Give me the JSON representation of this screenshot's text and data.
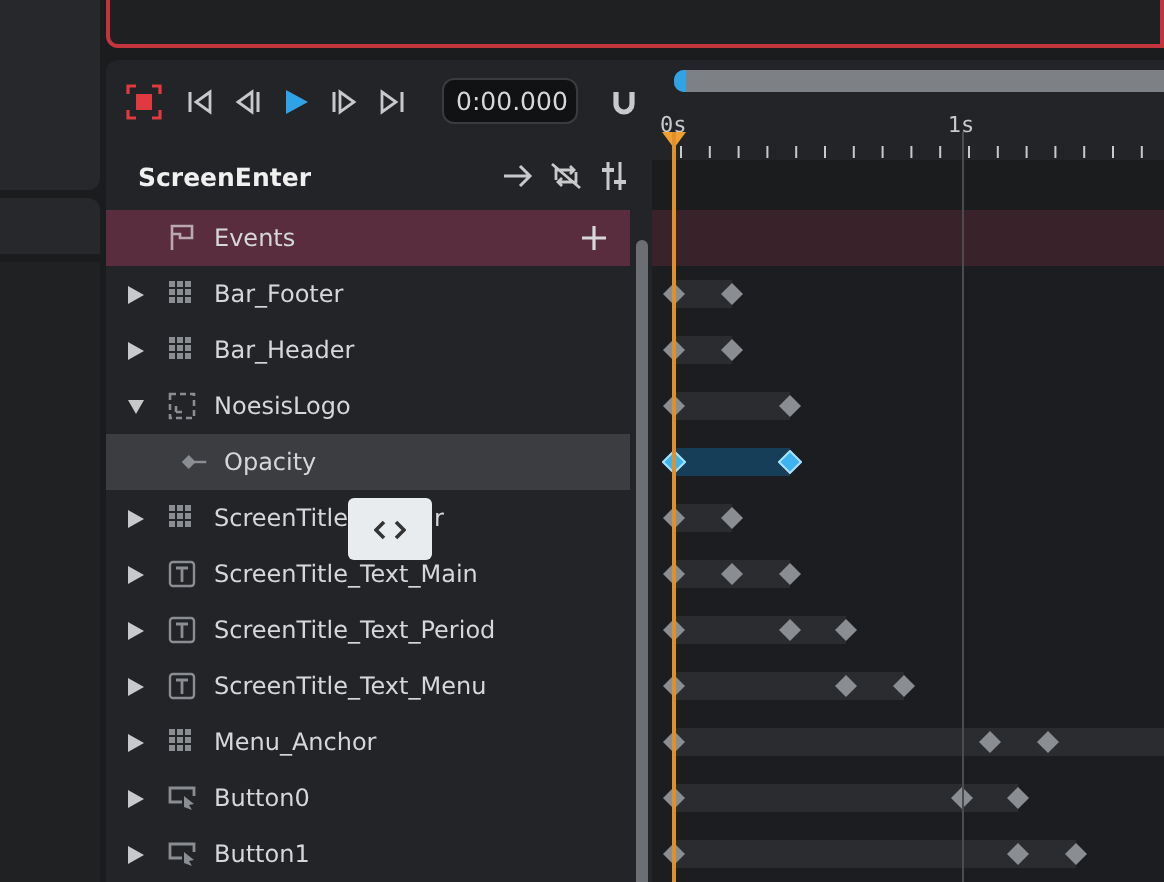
{
  "toolbar": {
    "time": "0:00.000"
  },
  "timeline": {
    "ruler": [
      {
        "label": "0s",
        "level": 0.043
      },
      {
        "label": "1s",
        "level": 0.605
      }
    ],
    "playhead": {
      "level": 0.043
    }
  },
  "animation": {
    "title": "ScreenEnter"
  },
  "events": {
    "label": "Events"
  },
  "tracks": [
    {
      "label": "Bar_Footer",
      "kind": "panel",
      "expanded": false,
      "selected": false,
      "keys": [
        {
          "level": 0.043
        },
        {
          "level": 0.156
        }
      ]
    },
    {
      "label": "Bar_Header",
      "kind": "panel",
      "expanded": false,
      "selected": false,
      "keys": [
        {
          "level": 0.043
        },
        {
          "level": 0.156
        }
      ]
    },
    {
      "label": "NoesisLogo",
      "kind": "image",
      "expanded": true,
      "selected": false,
      "keys": [
        {
          "level": 0.043
        },
        {
          "level": 0.27
        }
      ],
      "children": [
        {
          "label": "Opacity",
          "kind": "property",
          "selected": true,
          "keys": [
            {
              "level": 0.043
            },
            {
              "level": 0.27
            }
          ]
        }
      ]
    },
    {
      "label": "ScreenTitle",
      "label_end": "r",
      "kind": "panel",
      "expanded": false,
      "selected": false,
      "keys": [
        {
          "level": 0.043
        },
        {
          "level": 0.156
        }
      ]
    },
    {
      "label": "ScreenTitle_Text_Main",
      "kind": "text",
      "expanded": false,
      "selected": false,
      "keys": [
        {
          "level": 0.043
        },
        {
          "level": 0.156
        },
        {
          "level": 0.27
        }
      ]
    },
    {
      "label": "ScreenTitle_Text_Period",
      "kind": "text",
      "expanded": false,
      "selected": false,
      "keys": [
        {
          "level": 0.043
        },
        {
          "level": 0.27
        },
        {
          "level": 0.379
        }
      ]
    },
    {
      "label": "ScreenTitle_Text_Menu",
      "kind": "text",
      "expanded": false,
      "selected": false,
      "keys": [
        {
          "level": 0.043
        },
        {
          "level": 0.379
        },
        {
          "level": 0.492
        }
      ]
    },
    {
      "label": "Menu_Anchor",
      "kind": "panel",
      "expanded": false,
      "selected": false,
      "continues": true,
      "keys": [
        {
          "level": 0.043
        },
        {
          "level": 0.66
        },
        {
          "level": 0.773
        }
      ]
    },
    {
      "label": "Button0",
      "kind": "button",
      "expanded": false,
      "selected": false,
      "keys": [
        {
          "level": 0.043
        },
        {
          "level": 0.605
        },
        {
          "level": 0.715
        }
      ]
    },
    {
      "label": "Button1",
      "kind": "button",
      "expanded": false,
      "selected": false,
      "keys": [
        {
          "level": 0.043
        },
        {
          "level": 0.715
        },
        {
          "level": 0.828
        }
      ]
    }
  ]
}
